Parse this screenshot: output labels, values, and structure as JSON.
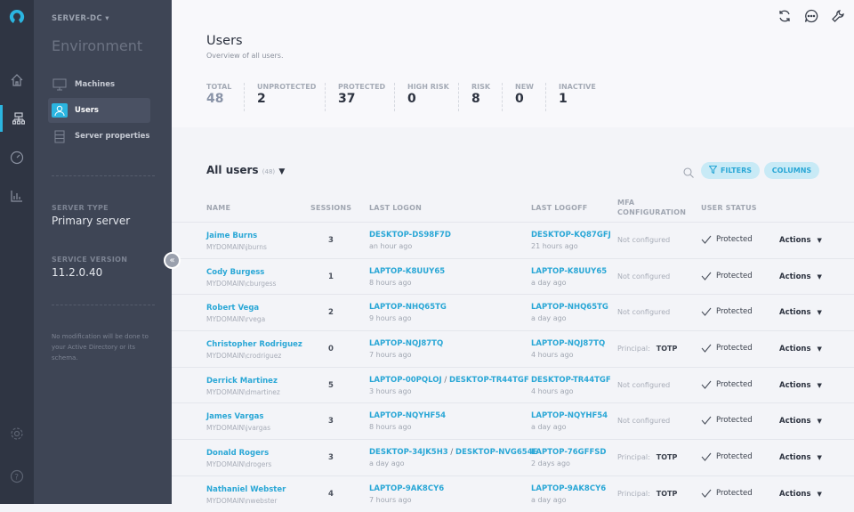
{
  "sidebar": {
    "server": "SERVER-DC",
    "section": "Environment",
    "items": [
      {
        "label": "Machines"
      },
      {
        "label": "Users"
      },
      {
        "label": "Server properties"
      }
    ],
    "server_type_label": "SERVER TYPE",
    "server_type": "Primary server",
    "service_version_label": "SERVICE VERSION",
    "service_version": "11.2.0.40",
    "note": "No modification will be done to your Active Directory or its schema."
  },
  "header": {
    "title": "Users",
    "subtitle": "Overview of all users."
  },
  "stats": [
    {
      "label": "TOTAL",
      "value": "48"
    },
    {
      "label": "UNPROTECTED",
      "value": "2"
    },
    {
      "label": "PROTECTED",
      "value": "37"
    },
    {
      "label": "HIGH RISK",
      "value": "0"
    },
    {
      "label": "RISK",
      "value": "8"
    },
    {
      "label": "NEW",
      "value": "0"
    },
    {
      "label": "INACTIVE",
      "value": "1"
    }
  ],
  "list": {
    "title": "All users",
    "count": "(48)",
    "filters": "FILTERS",
    "columns_btn": "COLUMNS"
  },
  "columns": {
    "name": "NAME",
    "sessions": "SESSIONS",
    "last_logon": "LAST LOGON",
    "last_logoff": "LAST LOGOFF",
    "mfa1": "MFA",
    "mfa2": "CONFIGURATION",
    "status": "USER STATUS"
  },
  "rows": [
    {
      "name": "Jaime Burns",
      "domain": "MYDOMAIN\\jburns",
      "sessions": "3",
      "logon": "DESKTOP-DS98F7D",
      "logon2": "",
      "logon_time": "an hour ago",
      "logoff": "DESKTOP-KQ87GFJ",
      "logoff_time": "21 hours ago",
      "mfa": "Not configured",
      "mfa_val": "",
      "status": "Protected",
      "actions": "Actions"
    },
    {
      "name": "Cody Burgess",
      "domain": "MYDOMAIN\\cburgess",
      "sessions": "1",
      "logon": "LAPTOP-K8UUY65",
      "logon2": "",
      "logon_time": "8 hours ago",
      "logoff": "LAPTOP-K8UUY65",
      "logoff_time": "a day ago",
      "mfa": "Not configured",
      "mfa_val": "",
      "status": "Protected",
      "actions": "Actions"
    },
    {
      "name": "Robert Vega",
      "domain": "MYDOMAIN\\rvega",
      "sessions": "2",
      "logon": "LAPTOP-NHQ65TG",
      "logon2": "",
      "logon_time": "9 hours ago",
      "logoff": "LAPTOP-NHQ65TG",
      "logoff_time": "a day ago",
      "mfa": "Not configured",
      "mfa_val": "",
      "status": "Protected",
      "actions": "Actions"
    },
    {
      "name": "Christopher Rodriguez",
      "domain": "MYDOMAIN\\crodriguez",
      "sessions": "0",
      "logon": "LAPTOP-NQJ87TQ",
      "logon2": "",
      "logon_time": "7 hours ago",
      "logoff": "LAPTOP-NQJ87TQ",
      "logoff_time": "4 hours ago",
      "mfa": "Principal:",
      "mfa_val": "TOTP",
      "status": "Protected",
      "actions": "Actions"
    },
    {
      "name": "Derrick Martinez",
      "domain": "MYDOMAIN\\dmartinez",
      "sessions": "5",
      "logon": "LAPTOP-00PQLOJ",
      "logon2": "DESKTOP-TR44TGF",
      "logon_time": "3 hours ago",
      "logoff": "DESKTOP-TR44TGF",
      "logoff_time": "4 hours ago",
      "mfa": "Not configured",
      "mfa_val": "",
      "status": "Protected",
      "actions": "Actions"
    },
    {
      "name": "James Vargas",
      "domain": "MYDOMAIN\\jvargas",
      "sessions": "3",
      "logon": "LAPTOP-NQYHF54",
      "logon2": "",
      "logon_time": "8 hours ago",
      "logoff": "LAPTOP-NQYHF54",
      "logoff_time": "a day ago",
      "mfa": "Not configured",
      "mfa_val": "",
      "status": "Protected",
      "actions": "Actions"
    },
    {
      "name": "Donald Rogers",
      "domain": "MYDOMAIN\\drogers",
      "sessions": "3",
      "logon": "DESKTOP-34JK5H3",
      "logon2": "DESKTOP-NVG654E",
      "logon_time": "a day ago",
      "logoff": "LAPTOP-76GFFSD",
      "logoff_time": "2 days ago",
      "mfa": "Principal:",
      "mfa_val": "TOTP",
      "status": "Protected",
      "actions": "Actions"
    },
    {
      "name": "Nathaniel Webster",
      "domain": "MYDOMAIN\\nwebster",
      "sessions": "4",
      "logon": "LAPTOP-9AK8CY6",
      "logon2": "",
      "logon_time": "7 hours ago",
      "logoff": "LAPTOP-9AK8CY6",
      "logoff_time": "a day ago",
      "mfa": "Principal:",
      "mfa_val": "TOTP",
      "status": "Protected",
      "actions": "Actions"
    }
  ]
}
